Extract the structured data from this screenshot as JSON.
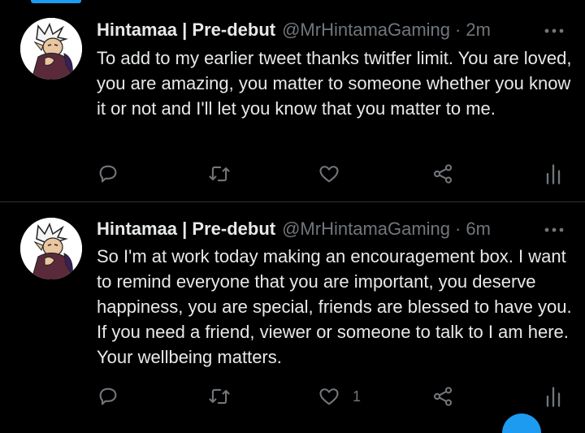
{
  "colors": {
    "background": "#000000",
    "text_primary": "#e7e9ea",
    "text_secondary": "#71767b",
    "accent": "#1d9bf0",
    "divider": "#2f3336"
  },
  "tweets": [
    {
      "display_name": "Hintamaa | Pre-debut",
      "handle": "@MrHintamaGaming",
      "separator": "·",
      "time": "2m",
      "text": "To add to my earlier tweet thanks twitfer limit. You are loved, you are amazing, you matter to someone whether you know it or not and I'll let you know that you matter to me.",
      "actions": {
        "reply_icon": "reply-icon",
        "retweet_icon": "retweet-icon",
        "like_icon": "heart-icon",
        "like_count": "",
        "share_icon": "share-icon",
        "analytics_icon": "analytics-icon"
      }
    },
    {
      "display_name": "Hintamaa | Pre-debut",
      "handle": "@MrHintamaGaming",
      "separator": "·",
      "time": "6m",
      "text": "So I'm at work today making an encouragement box. I want to remind everyone that you are important, you deserve happiness, you are special, friends are blessed to have you. If you need a friend, viewer or someone to talk to I am here. Your wellbeing matters.",
      "actions": {
        "reply_icon": "reply-icon",
        "retweet_icon": "retweet-icon",
        "like_icon": "heart-icon",
        "like_count": "1",
        "share_icon": "share-icon",
        "analytics_icon": "analytics-icon"
      }
    }
  ]
}
